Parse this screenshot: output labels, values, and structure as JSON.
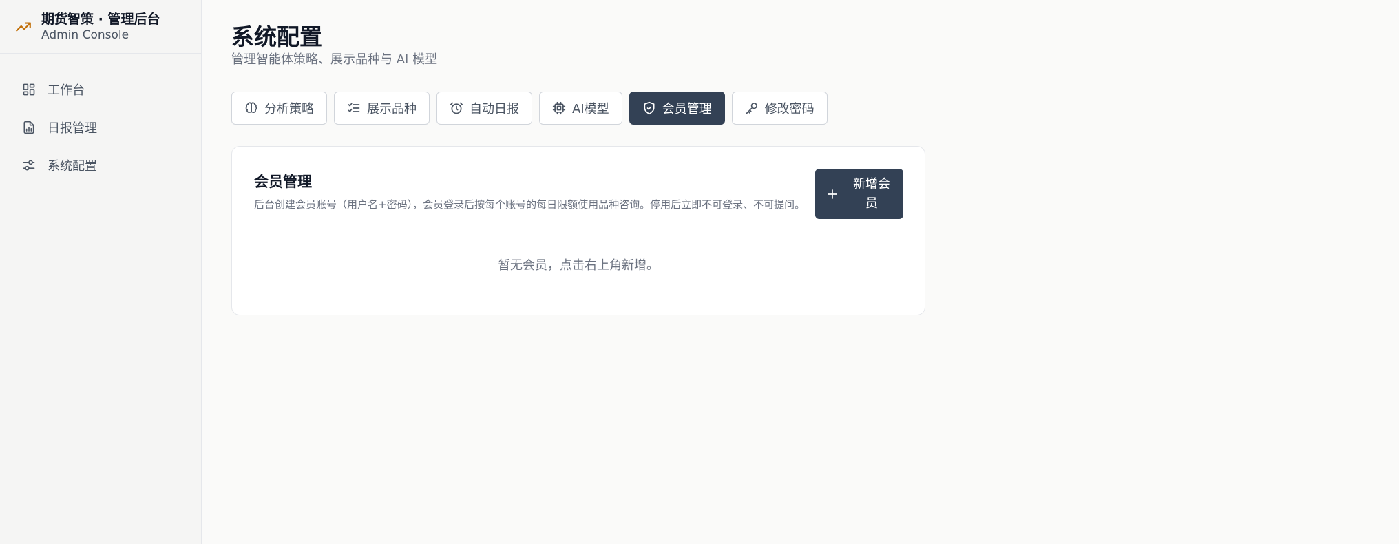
{
  "brand": {
    "title": "期货智策 · 管理后台",
    "subtitle": "Admin Console",
    "accent": "#c2700a"
  },
  "sidebar": {
    "items": [
      {
        "label": "工作台",
        "icon": "dashboard-icon"
      },
      {
        "label": "日报管理",
        "icon": "file-chart-icon"
      },
      {
        "label": "系统配置",
        "icon": "sliders-icon"
      }
    ]
  },
  "page": {
    "title": "系统配置",
    "subtitle": "管理智能体策略、展示品种与 AI 模型"
  },
  "tabs": [
    {
      "label": "分析策略",
      "icon": "brain-icon"
    },
    {
      "label": "展示品种",
      "icon": "list-check-icon"
    },
    {
      "label": "自动日报",
      "icon": "alarm-clock-icon"
    },
    {
      "label": "AI模型",
      "icon": "cpu-icon"
    },
    {
      "label": "会员管理",
      "icon": "shield-check-icon",
      "active": true
    },
    {
      "label": "修改密码",
      "icon": "key-icon"
    }
  ],
  "member": {
    "title": "会员管理",
    "description": "后台创建会员账号（用户名+密码），会员登录后按每个账号的每日限额使用品种咨询。停用后立即不可登录、不可提问。",
    "add_button": "新增会员",
    "empty_text": "暂无会员，点击右上角新增。"
  },
  "colors": {
    "primary": "#334155",
    "background": "#fafaf9"
  }
}
